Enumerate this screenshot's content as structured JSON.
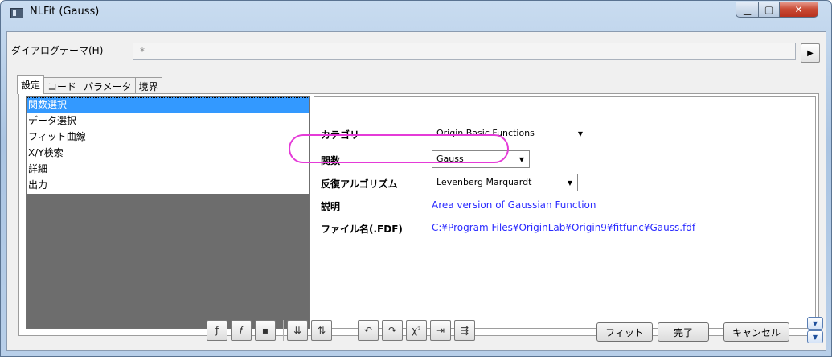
{
  "window": {
    "title": "NLFit (Gauss)"
  },
  "theme": {
    "label": "ダイアログテーマ(H)",
    "value": "*"
  },
  "tabs": [
    {
      "label": "設定",
      "active": true
    },
    {
      "label": "コード",
      "active": false
    },
    {
      "label": "パラメータ",
      "active": false
    },
    {
      "label": "境界",
      "active": false
    }
  ],
  "nav": {
    "items": [
      "関数選択",
      "データ選択",
      "フィット曲線",
      "X/Y検索",
      "詳細",
      "出力"
    ],
    "selected": 0
  },
  "settings": {
    "category_label": "カテゴリ",
    "category_value": "Origin Basic Functions",
    "function_label": "関数",
    "function_value": "Gauss",
    "algorithm_label": "反復アルゴリズム",
    "algorithm_value": "Levenberg Marquardt",
    "description_label": "説明",
    "description_value": "Area version of Gaussian Function",
    "file_label": "ファイル名(.FDF)",
    "file_value": "C:¥Program Files¥OriginLab¥Origin9¥fitfunc¥Gauss.fdf"
  },
  "buttons": {
    "fit": "フィット",
    "done": "完了",
    "cancel": "キャンセル"
  },
  "colors": {
    "selection": "#3399ff",
    "link": "#2b2bff",
    "highlight": "#e53bd8",
    "close": "#c94a34"
  }
}
